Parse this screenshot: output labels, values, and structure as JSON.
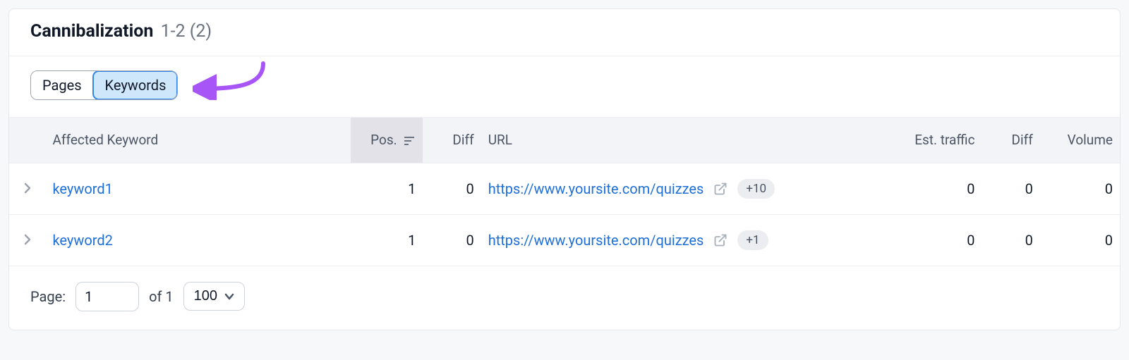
{
  "header": {
    "title": "Cannibalization",
    "range": "1-2 (2)"
  },
  "tabs": {
    "pages": "Pages",
    "keywords": "Keywords"
  },
  "columns": {
    "affected_keyword": "Affected Keyword",
    "pos": "Pos.",
    "diff": "Diff",
    "url": "URL",
    "est_traffic": "Est. traffic",
    "diff2": "Diff",
    "volume": "Volume"
  },
  "rows": [
    {
      "keyword": "keyword1",
      "pos": "1",
      "diff": "0",
      "url": "https://www.yoursite.com/quizzes",
      "more_badge": "+10",
      "est_traffic": "0",
      "diff2": "0",
      "volume": "0"
    },
    {
      "keyword": "keyword2",
      "pos": "1",
      "diff": "0",
      "url": "https://www.yoursite.com/quizzes",
      "more_badge": "+1",
      "est_traffic": "0",
      "diff2": "0",
      "volume": "0"
    }
  ],
  "pagination": {
    "label": "Page:",
    "current": "1",
    "of_text": "of 1",
    "page_size": "100"
  }
}
